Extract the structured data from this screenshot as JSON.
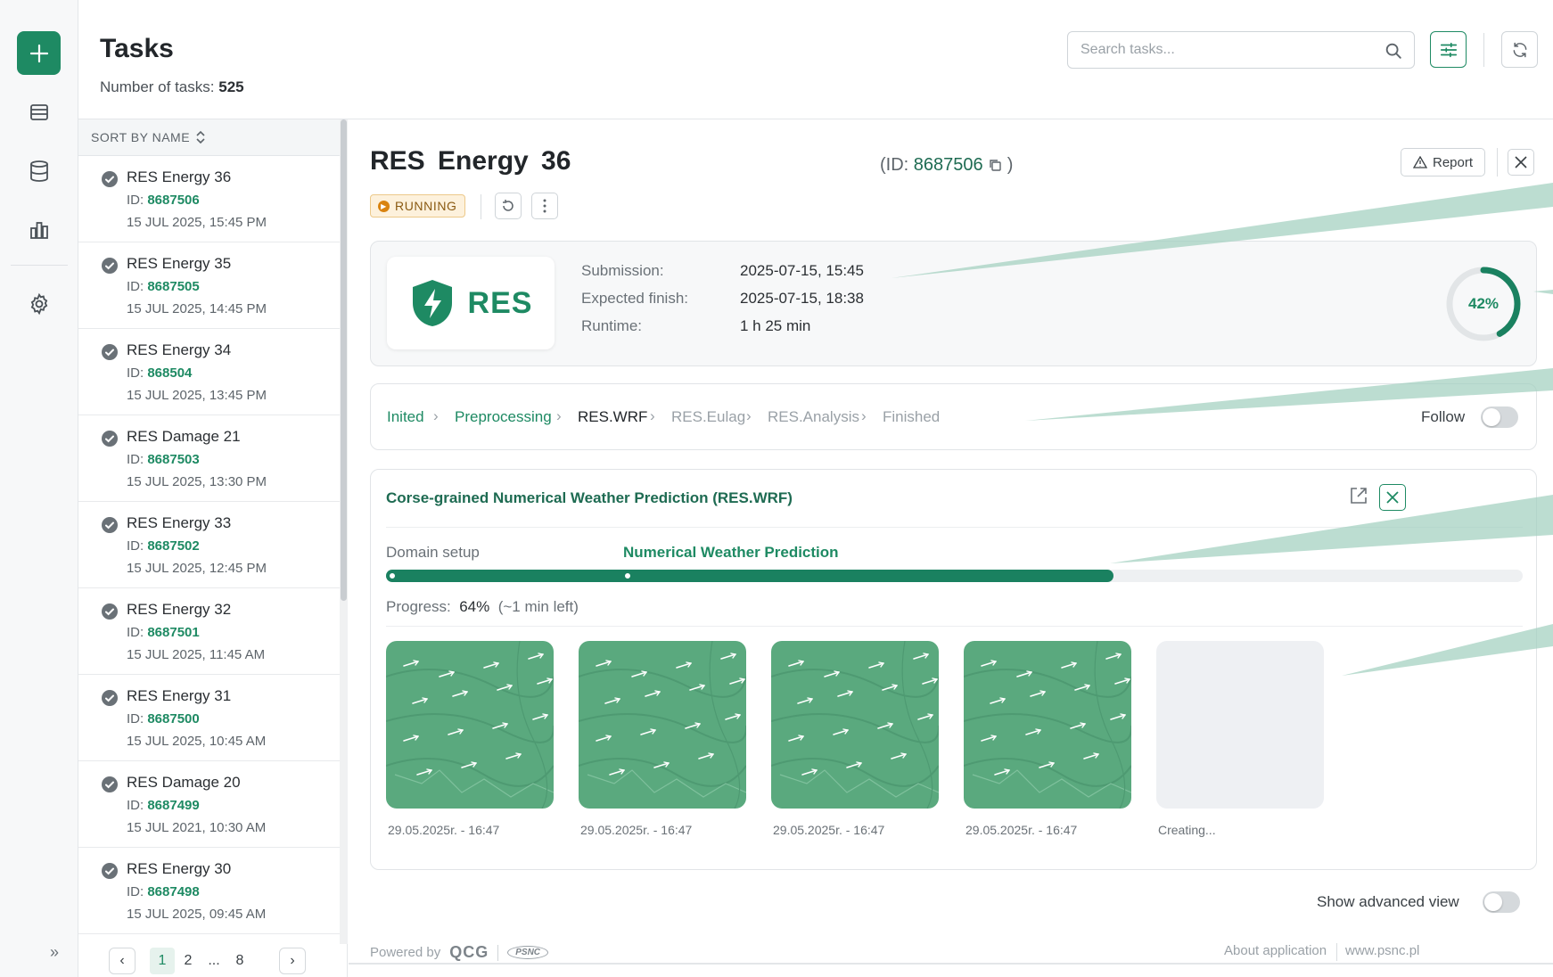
{
  "header": {
    "title": "Tasks",
    "count_label": "Number of tasks:",
    "count_value": "525",
    "search_placeholder": "Search tasks..."
  },
  "list": {
    "sort_label": "SORT BY NAME",
    "id_prefix": "ID:",
    "items": [
      {
        "name": "RES Energy 36",
        "id": "8687506",
        "date": "15 JUL 2025, 15:45 PM"
      },
      {
        "name": "RES Energy 35",
        "id": "8687505",
        "date": "15 JUL 2025, 14:45 PM"
      },
      {
        "name": "RES Energy 34",
        "id": "868504",
        "date": "15 JUL 2025, 13:45 PM"
      },
      {
        "name": "RES Damage 21",
        "id": "8687503",
        "date": "15 JUL 2025, 13:30 PM"
      },
      {
        "name": "RES Energy 33",
        "id": "8687502",
        "date": "15 JUL 2025, 12:45 PM"
      },
      {
        "name": "RES Energy 32",
        "id": "8687501",
        "date": "15 JUL 2025, 11:45 AM"
      },
      {
        "name": "RES Energy 31",
        "id": "8687500",
        "date": "15 JUL 2025, 10:45 AM"
      },
      {
        "name": "RES Damage 20",
        "id": "8687499",
        "date": "15 JUL 2021, 10:30 AM"
      },
      {
        "name": "RES Energy 30",
        "id": "8687498",
        "date": "15 JUL 2025, 09:45 AM"
      }
    ],
    "pager": {
      "prev": "‹",
      "p1": "1",
      "p2": "2",
      "ellipsis": "...",
      "p8": "8",
      "next": "›"
    }
  },
  "detail": {
    "title": "RES Energy  36",
    "id_prefix": "(ID:",
    "id_value": "8687506",
    "id_suffix": ")",
    "report_label": "Report",
    "status": "RUNNING",
    "logo_text": "RES",
    "info": {
      "submission_label": "Submission:",
      "submission_value": "2025-07-15, 15:45",
      "expected_label": "Expected finish:",
      "expected_value": "2025-07-15, 18:38",
      "runtime_label": "Runtime:",
      "runtime_value": "1 h 25 min"
    },
    "overall_progress": 0.42,
    "overall_progress_label": "42%",
    "steps": [
      {
        "label": "Inited",
        "state": "done"
      },
      {
        "label": "Preprocessing",
        "state": "done"
      },
      {
        "label": "RES.WRF",
        "state": "current"
      },
      {
        "label": "RES.Eulag",
        "state": "todo"
      },
      {
        "label": "RES.Analysis",
        "state": "todo"
      },
      {
        "label": "Finished",
        "state": "todo"
      }
    ],
    "follow_label": "Follow",
    "stage": {
      "title": "Corse-grained Numerical Weather Prediction (RES.WRF)",
      "sub1": "Domain setup",
      "sub2": "Numerical Weather Prediction",
      "progress": 0.64,
      "progress_label": "Progress:",
      "progress_value": "64%",
      "progress_eta": "(~1 min left)",
      "thumbs": [
        {
          "caption": "29.05.2025r. - 16:47"
        },
        {
          "caption": "29.05.2025r. - 16:47"
        },
        {
          "caption": "29.05.2025r. - 16:47"
        },
        {
          "caption": "29.05.2025r. - 16:47"
        },
        {
          "caption": "Creating..."
        }
      ]
    },
    "advanced_label": "Show advanced view"
  },
  "footer": {
    "powered_by": "Powered by",
    "qcg": "QCG",
    "psnc": "PSNC",
    "about": "About application",
    "site": "www.psnc.pl"
  },
  "colors": {
    "accent": "#1e8a63",
    "running_bg": "#fdf1dc",
    "running_text": "#8a5a12"
  }
}
